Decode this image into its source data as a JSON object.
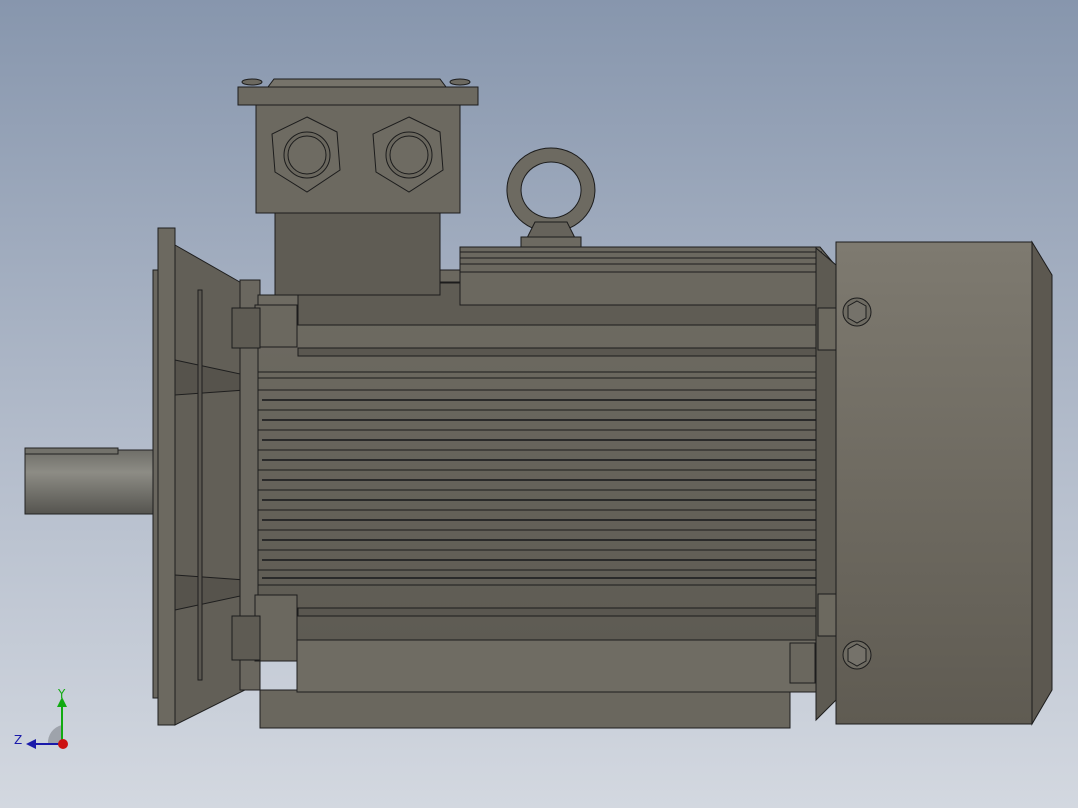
{
  "viewport": {
    "background_top": "#8796ad",
    "background_bottom": "#d3d8e0"
  },
  "model": {
    "description_visible": "",
    "body_color": "#6f6c63",
    "edge_color": "#1c1c1c",
    "fan_cover_color": "#7a766c",
    "shaft_color": "#7f7e77"
  },
  "triad": {
    "y_label": "Y",
    "z_label": "Z",
    "x_color": "#cc1111",
    "y_color": "#11aa11",
    "z_color": "#1a1aaa"
  }
}
